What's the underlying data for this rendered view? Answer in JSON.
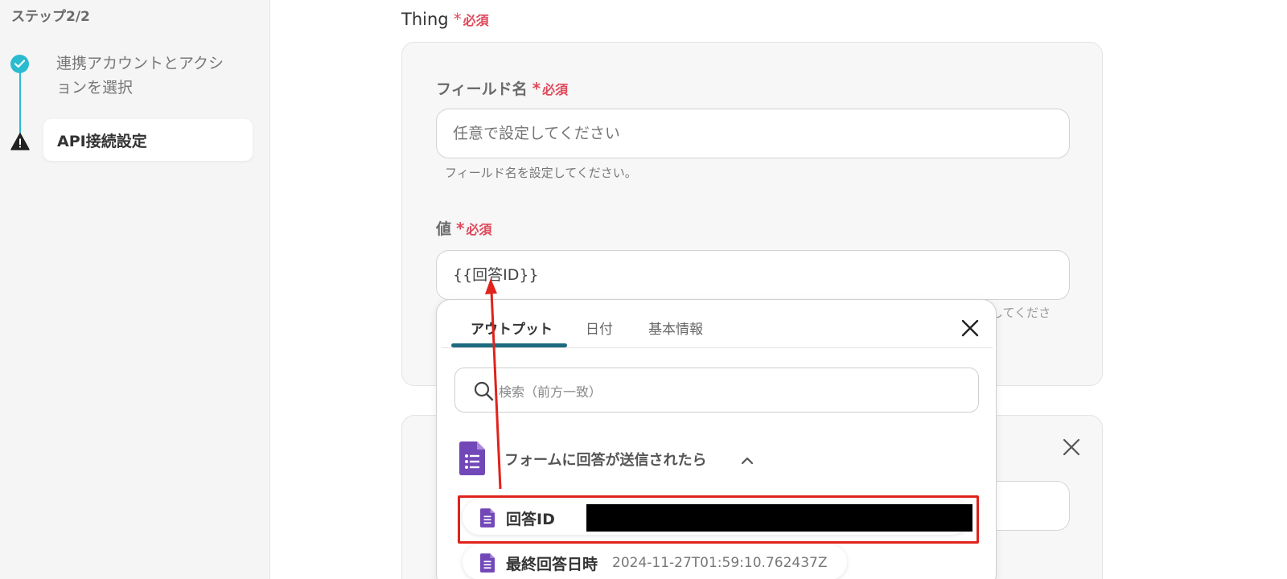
{
  "sidebar": {
    "step_title": "ステップ2/2",
    "steps": [
      {
        "label_line1": "連携アカウントとアクシ",
        "label_line2": "ョンを選択",
        "status": "complete"
      },
      {
        "label": "API接続設定",
        "status": "warning"
      }
    ]
  },
  "main": {
    "section_label": "Thing",
    "required_text": "必須",
    "field_name": {
      "label": "フィールド名",
      "placeholder": "任意で設定してください",
      "hint": "フィールド名を設定してください。"
    },
    "value_field": {
      "label": "値",
      "value": "{{回答ID}}",
      "hint_tail": "してくださ"
    }
  },
  "dropdown": {
    "tabs": [
      {
        "label": "アウトプット",
        "active": true
      },
      {
        "label": "日付",
        "active": false
      },
      {
        "label": "基本情報",
        "active": false
      }
    ],
    "search_placeholder": "検索（前方一致）",
    "group_title": "フォームに回答が送信されたら",
    "items": [
      {
        "label": "回答ID",
        "value": ""
      },
      {
        "label": "最終回答日時",
        "value": "2024-11-27T01:59:10.762437Z"
      }
    ]
  },
  "colors": {
    "accent_teal": "#2bbbd0",
    "tab_underline": "#1d6a7f",
    "required_red": "#e0485b",
    "highlight_red": "#e0231b",
    "forms_purple": "#7248b9"
  },
  "icons": [
    "check-icon",
    "warning-icon",
    "close-icon",
    "search-icon",
    "google-forms-icon",
    "chevron-up-icon"
  ]
}
